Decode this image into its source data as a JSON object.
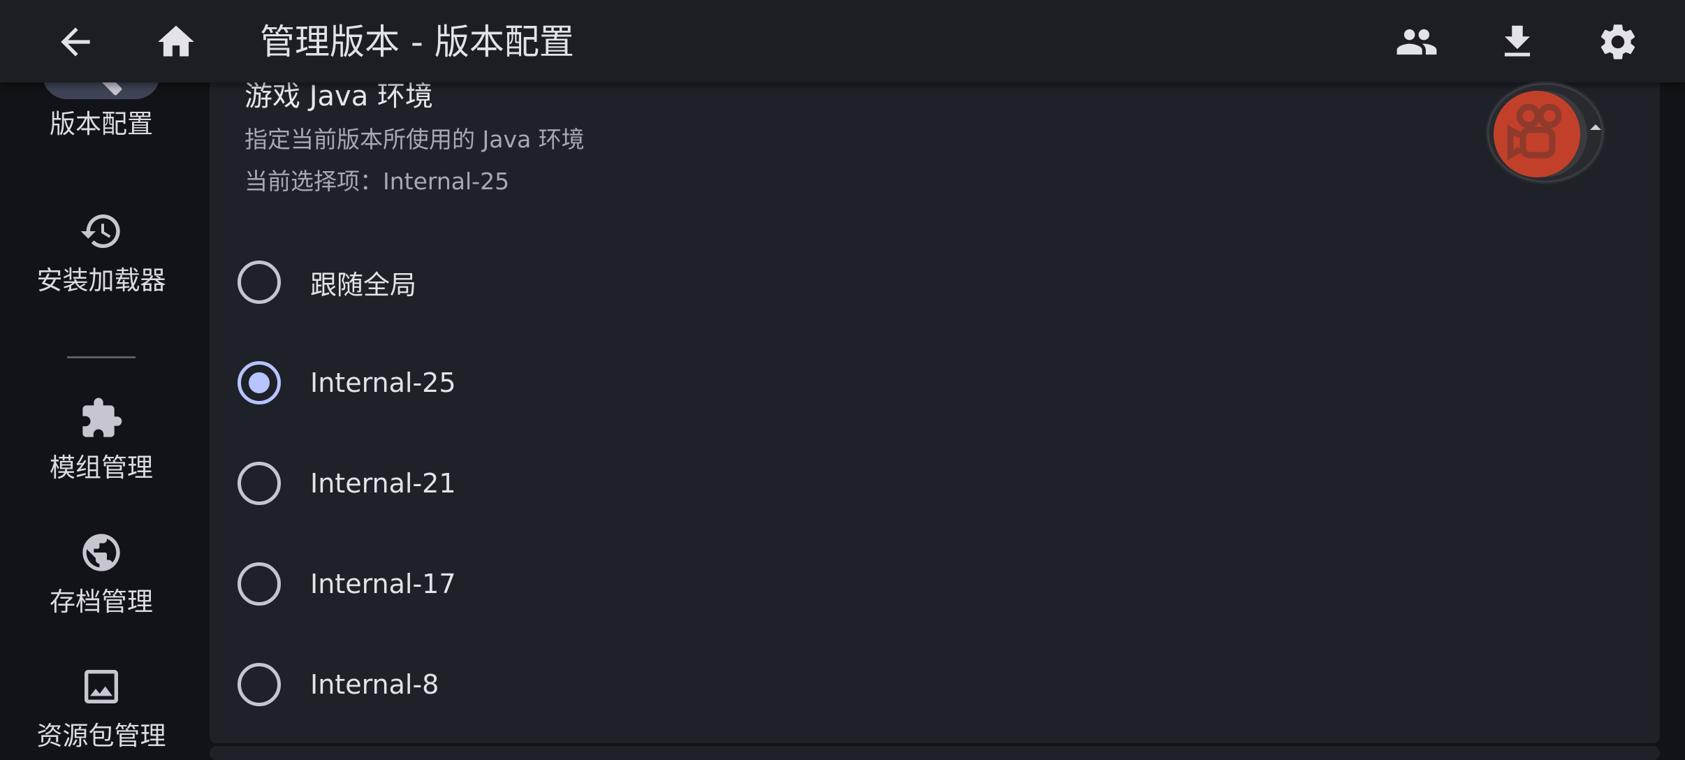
{
  "topbar": {
    "title": "管理版本 - 版本配置",
    "back_icon": "arrow-back-icon",
    "home_icon": "home-icon",
    "accounts_icon": "people-icon",
    "download_icon": "download-icon",
    "settings_icon": "gear-icon"
  },
  "sidebar": {
    "items": [
      {
        "label": "版本配置",
        "icon": "wrench-icon",
        "active": true
      },
      {
        "label": "安装加载器",
        "icon": "history-icon",
        "active": false
      },
      {
        "label": "模组管理",
        "icon": "puzzle-icon",
        "active": false
      },
      {
        "label": "存档管理",
        "icon": "globe-icon",
        "active": false
      },
      {
        "label": "资源包管理",
        "icon": "image-icon",
        "active": false
      }
    ]
  },
  "java_section": {
    "title": "游戏 Java 环境",
    "description": "指定当前版本所使用的 Java 环境",
    "current_label": "当前选择项：Internal-25",
    "options": [
      {
        "label": "跟随全局",
        "selected": false
      },
      {
        "label": "Internal-25",
        "selected": true
      },
      {
        "label": "Internal-21",
        "selected": false
      },
      {
        "label": "Internal-17",
        "selected": false
      },
      {
        "label": "Internal-8",
        "selected": false
      }
    ]
  },
  "floating_button": {
    "icon": "camera-record-icon",
    "color": "#c2402a"
  },
  "colors": {
    "background": "#121318",
    "surface": "#1f2129",
    "topbar": "#1c1e24",
    "accent": "#b7c4ff",
    "nav_active": "#3e4456"
  }
}
